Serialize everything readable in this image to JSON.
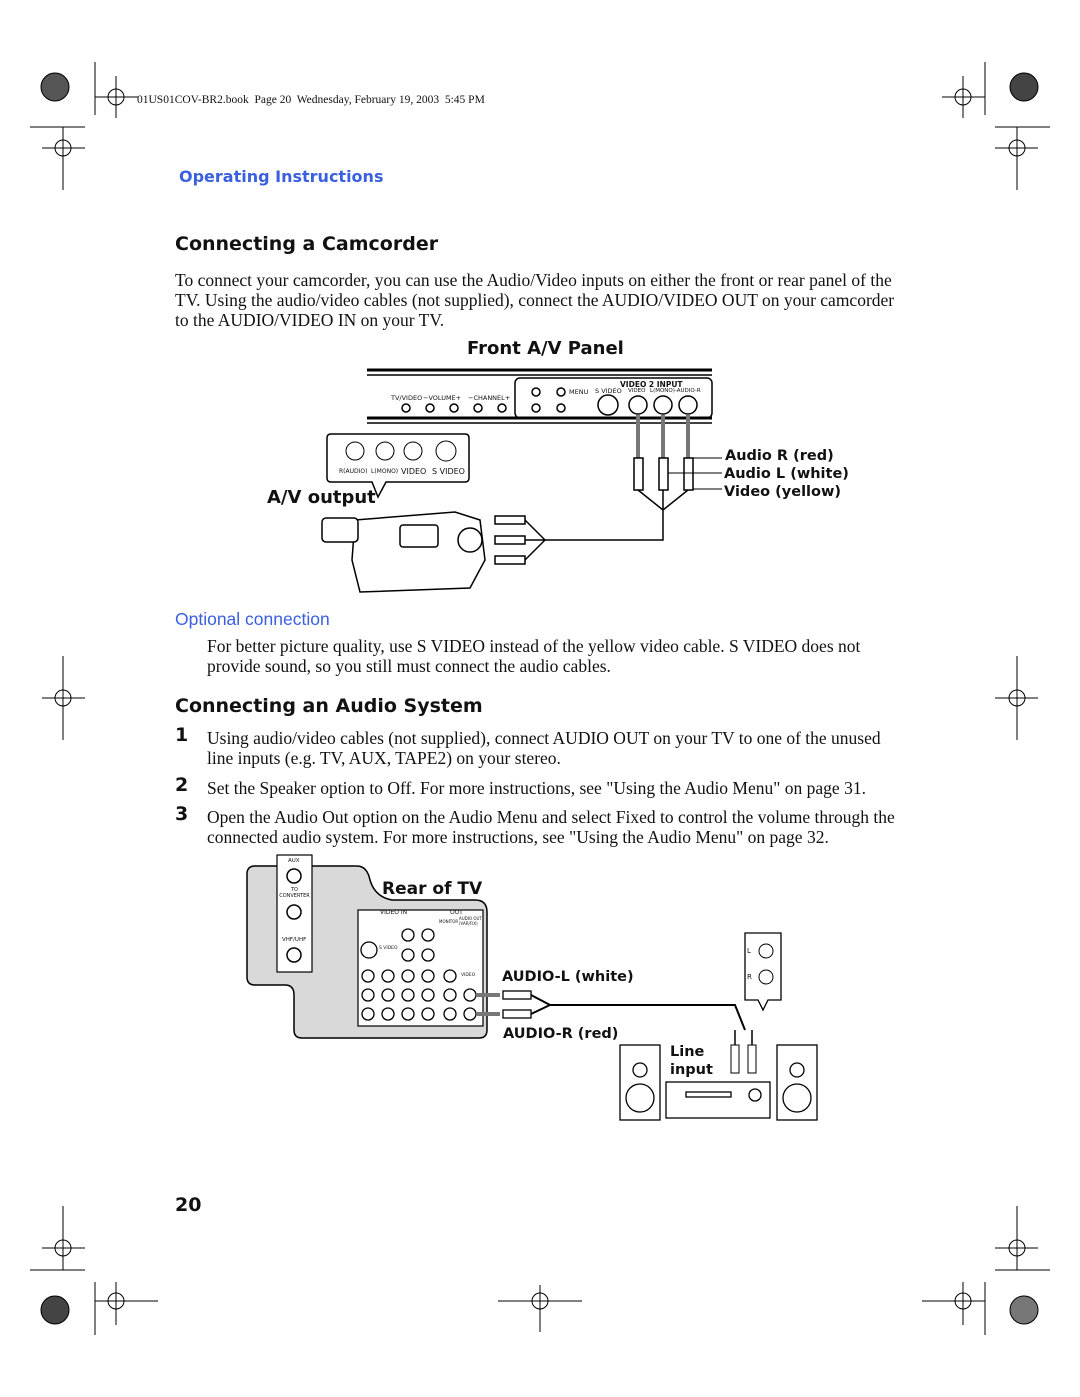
{
  "header": {
    "file_info": "01US01COV-BR2.book  Page 20  Wednesday, February 19, 2003  5:45 PM"
  },
  "section_title": "Operating Instructions",
  "camcorder": {
    "heading": "Connecting a Camcorder",
    "intro": "To connect your camcorder, you can use the Audio/Video inputs on either the front or rear panel of the TV. Using the audio/video cables (not supplied), connect the AUDIO/VIDEO OUT on your camcorder to the AUDIO/VIDEO IN on your TV.",
    "diagram": {
      "title": "Front A/V Panel",
      "panel_labels": [
        "TV/VIDEO",
        "−VOLUME+",
        "−CHANNEL+",
        "MENU",
        "S VIDEO",
        "VIDEO 2 INPUT",
        "VIDEO",
        "L(MONO)-AUDIO-R"
      ],
      "camcorder_jacks": [
        "R(AUDIO)",
        "L(MONO)",
        "VIDEO",
        "S VIDEO"
      ],
      "av_output": "A/V output",
      "cable_labels": [
        "Audio R (red)",
        "Audio L (white)",
        "Video (yellow)"
      ]
    },
    "optional_heading": "Optional connection",
    "optional_text": "For better picture quality, use S VIDEO instead of the yellow video cable. S VIDEO does not provide sound, so you still must connect the audio cables."
  },
  "audio": {
    "heading": "Connecting an Audio System",
    "steps": [
      {
        "num": "1",
        "text": "Using audio/video cables (not supplied), connect AUDIO OUT on your TV to one of the unused line inputs (e.g. TV, AUX, TAPE2) on your stereo."
      },
      {
        "num": "2",
        "text": "Set the Speaker option to Off. For more instructions, see \"Using the Audio Menu\" on page 31."
      },
      {
        "num": "3",
        "text": "Open the Audio Out option on the Audio Menu and select Fixed to control the volume through the connected audio system. For more instructions, see \"Using the Audio Menu\" on page 32."
      }
    ],
    "diagram": {
      "title": "Rear of TV",
      "antenna_labels": [
        "AUX",
        "TO CONVERTER",
        "VHF/UHF"
      ],
      "rear_labels": [
        "VIDEO IN",
        "OUT",
        "MONITOR",
        "AUDIO OUT (VAR/FIX)",
        "S VIDEO",
        "VIDEO"
      ],
      "cable_labels": [
        "AUDIO-L (white)",
        "AUDIO-R (red)"
      ],
      "stereo_jacks": [
        "L",
        "R"
      ],
      "line_input": "Line input"
    }
  },
  "page_number": "20",
  "colors": {
    "accent": "#3a5fe0",
    "panel_gray": "#d9d9d9"
  }
}
